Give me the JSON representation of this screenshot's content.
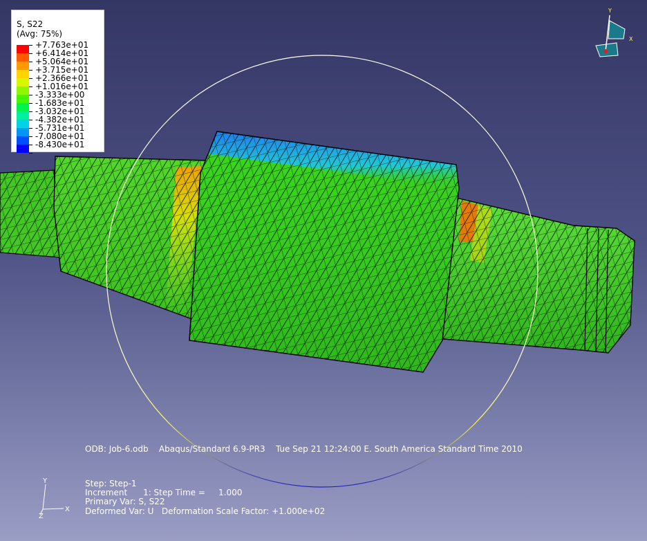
{
  "legend": {
    "title_line1": "S, S22",
    "title_line2": "(Avg: 75%)",
    "entries": [
      {
        "label": "+7.763e+01",
        "color": "#ff0000"
      },
      {
        "label": "+6.414e+01",
        "color": "#ff5a00"
      },
      {
        "label": "+5.064e+01",
        "color": "#ff9a00"
      },
      {
        "label": "+3.715e+01",
        "color": "#ffd500"
      },
      {
        "label": "+2.366e+01",
        "color": "#d9f700"
      },
      {
        "label": "+1.016e+01",
        "color": "#8ef700"
      },
      {
        "label": "-3.333e+00",
        "color": "#46f500"
      },
      {
        "label": "-1.683e+01",
        "color": "#00f34a"
      },
      {
        "label": "-3.032e+01",
        "color": "#00f0a0"
      },
      {
        "label": "-4.382e+01",
        "color": "#00d2e8"
      },
      {
        "label": "-5.731e+01",
        "color": "#0096f5"
      },
      {
        "label": "-7.080e+01",
        "color": "#004dff"
      },
      {
        "label": "-8.430e+01",
        "color": "#0000ff"
      }
    ]
  },
  "info": {
    "odb_line": "ODB: Job-6.odb    Abaqus/Standard 6.9-PR3    Tue Sep 21 12:24:00 E. South America Standard Time 2010",
    "step_line": "Step: Step-1",
    "increment_line": "Increment      1: Step Time =     1.000",
    "primary_var_line": "Primary Var: S, S22",
    "deformed_var_line": "Deformed Var: U   Deformation Scale Factor: +1.000e+02"
  },
  "triad": {
    "y": "Y",
    "x": "X",
    "z": "Z"
  },
  "compass": {
    "y": "Y",
    "x": "X"
  },
  "colors": {
    "mesh_green": "#3cd21e",
    "mesh_line": "#0a1a0a"
  }
}
